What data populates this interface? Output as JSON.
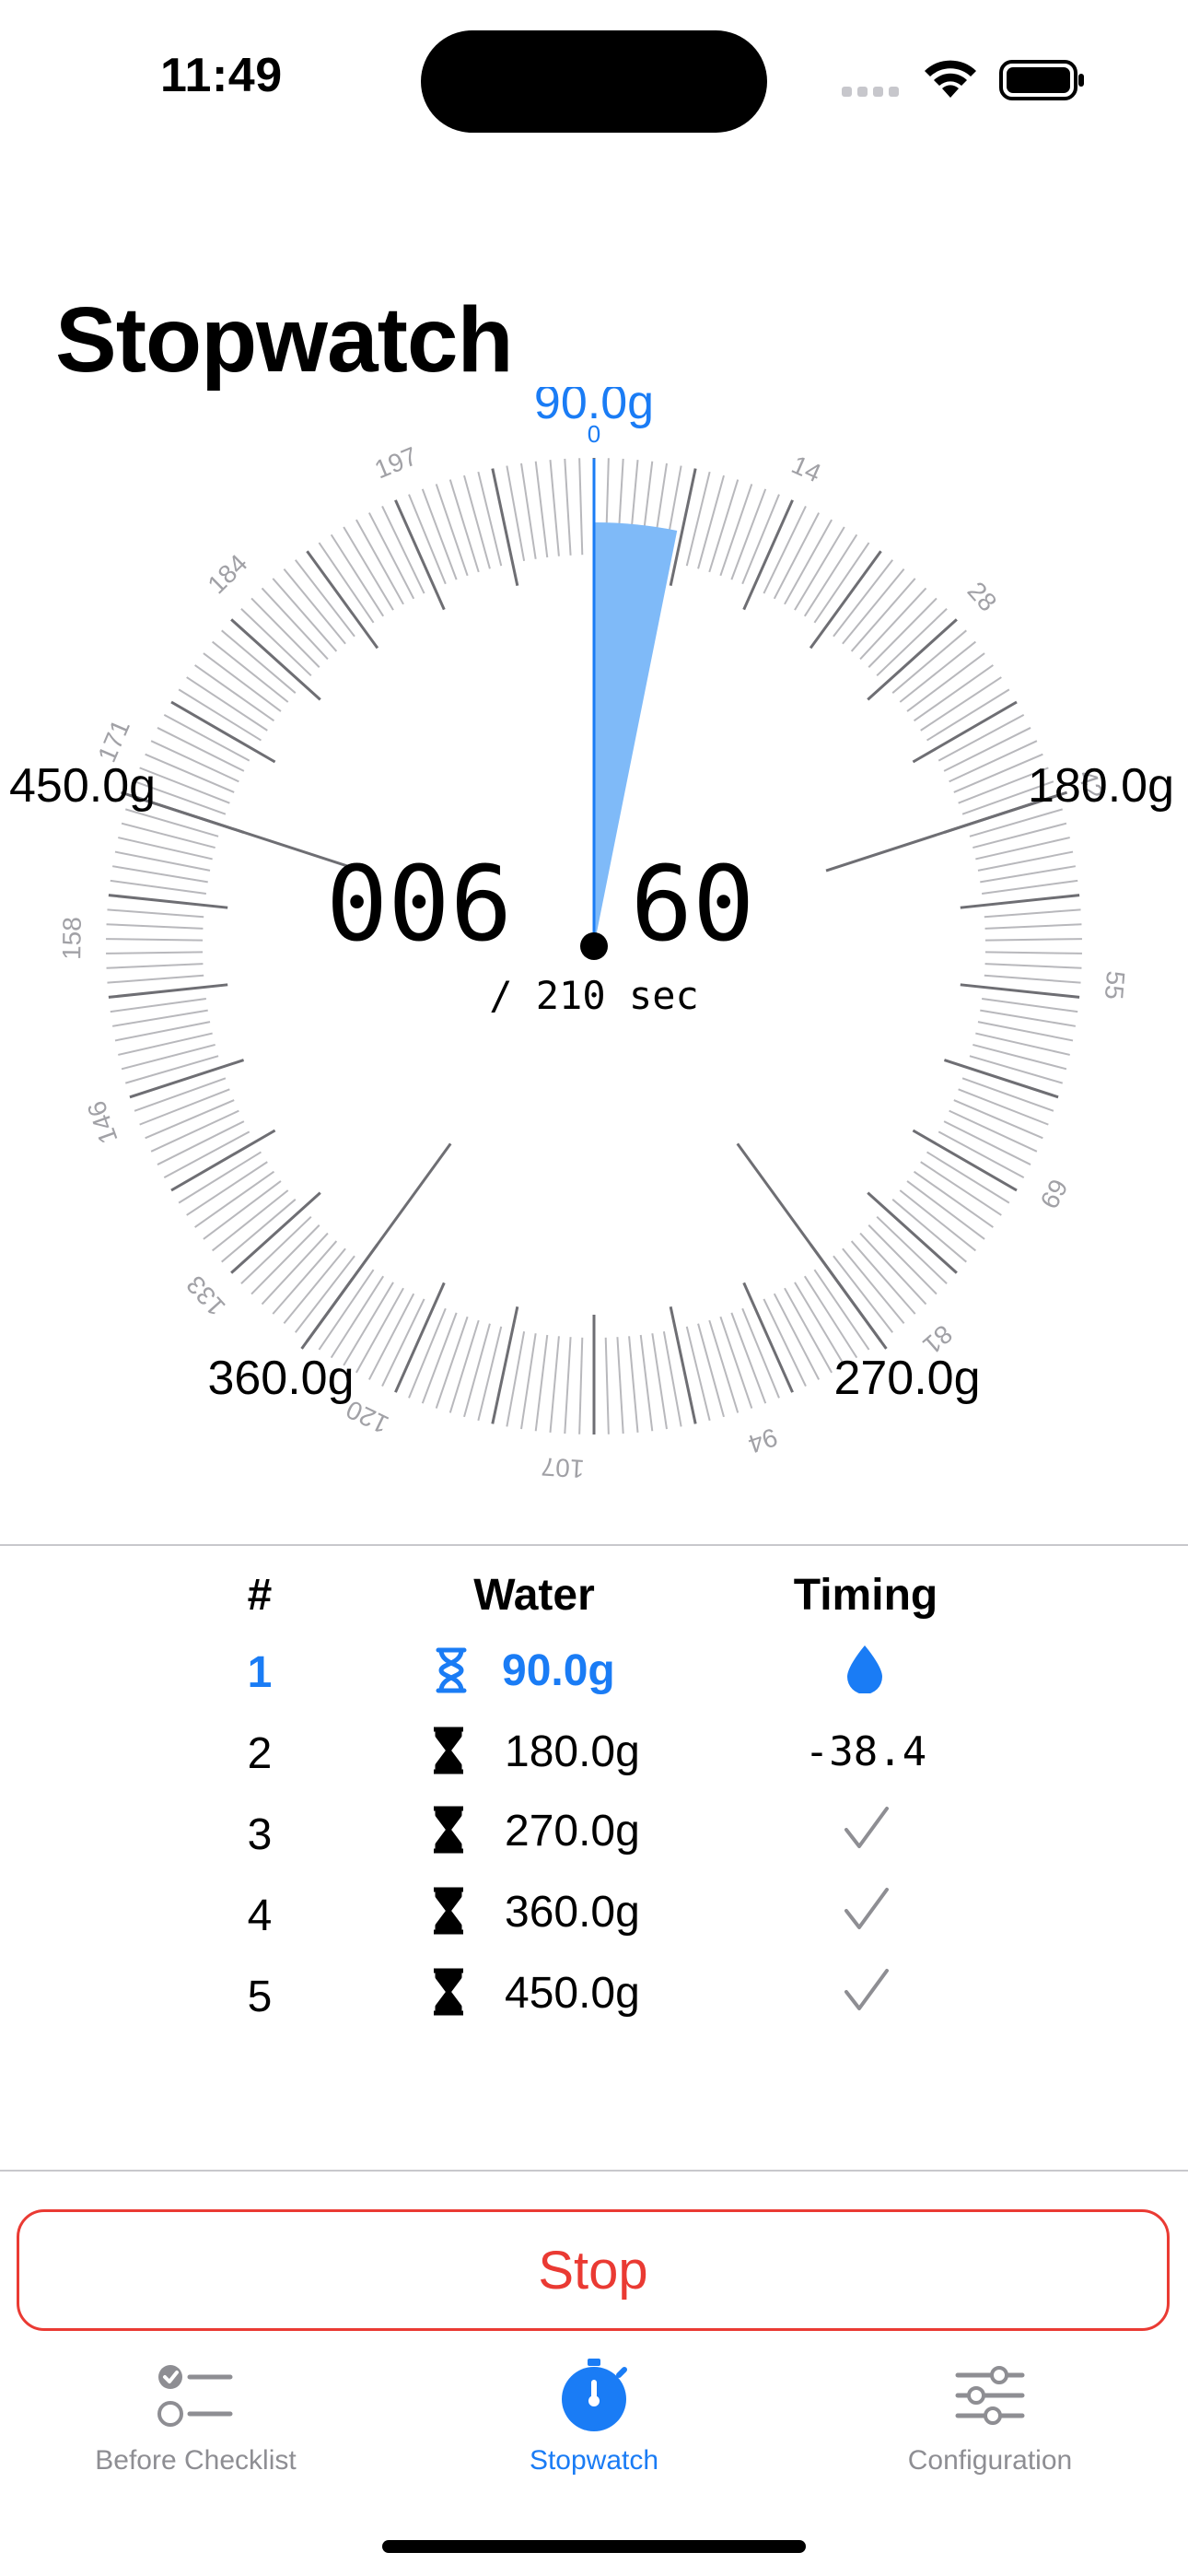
{
  "status_bar": {
    "time": "11:49"
  },
  "page_title": "Stopwatch",
  "dial": {
    "readout": {
      "seconds": "006",
      "hundredths": "60",
      "total": "/ 210 sec"
    },
    "target_label": "90.0g",
    "target_sublabel": "0",
    "milestone_labels": [
      "180.0g",
      "270.0g",
      "360.0g",
      "450.0g"
    ],
    "scale_numbers": [
      "14",
      "28",
      "42",
      "55",
      "69",
      "81",
      "94",
      "107",
      "120",
      "133",
      "146",
      "158",
      "171",
      "184",
      "197"
    ],
    "elapsed_seconds": 6.6,
    "total_seconds": 210,
    "accent_color": "#1a7cf5",
    "fill_color": "#7fbaf8"
  },
  "table": {
    "headers": {
      "number": "#",
      "water": "Water",
      "timing": "Timing"
    },
    "rows": [
      {
        "number": "1",
        "water": "90.0g",
        "timing": "",
        "timing_icon": "water-drop-icon",
        "active": true
      },
      {
        "number": "2",
        "water": "180.0g",
        "timing": "-38.4",
        "active": false
      },
      {
        "number": "3",
        "water": "270.0g",
        "timing": "",
        "timing_icon": "checkmark-icon",
        "active": false
      },
      {
        "number": "4",
        "water": "360.0g",
        "timing": "",
        "timing_icon": "checkmark-icon",
        "active": false
      },
      {
        "number": "5",
        "water": "450.0g",
        "timing": "",
        "timing_icon": "checkmark-icon",
        "active": false
      }
    ]
  },
  "stop_button": {
    "label": "Stop",
    "color": "#ea3a33"
  },
  "tab_bar": {
    "tabs": [
      {
        "label": "Before Checklist",
        "icon": "checklist-icon",
        "active": false
      },
      {
        "label": "Stopwatch",
        "icon": "stopwatch-icon",
        "active": true
      },
      {
        "label": "Configuration",
        "icon": "sliders-icon",
        "active": false
      }
    ]
  }
}
